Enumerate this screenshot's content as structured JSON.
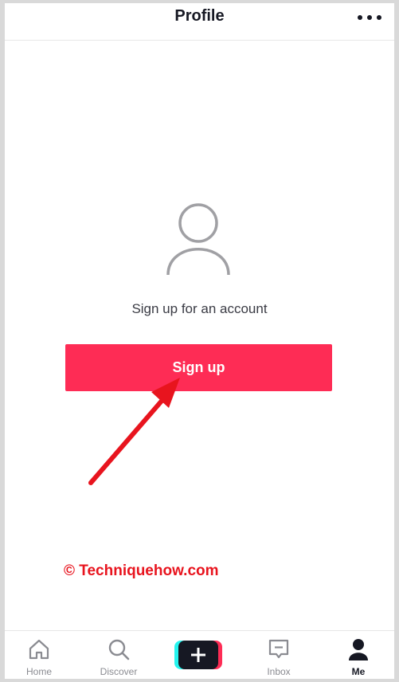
{
  "header": {
    "title": "Profile",
    "menu_icon": "more-horizontal-icon"
  },
  "main": {
    "avatar_icon": "user-placeholder-icon",
    "prompt": "Sign up for an account",
    "signup_label": "Sign up"
  },
  "watermark": "© Techniquehow.com",
  "tabbar": {
    "items": [
      {
        "label": "Home",
        "icon": "home-icon"
      },
      {
        "label": "Discover",
        "icon": "search-icon"
      },
      {
        "label": "",
        "icon": "plus-icon"
      },
      {
        "label": "Inbox",
        "icon": "inbox-icon"
      },
      {
        "label": "Me",
        "icon": "person-icon",
        "active": true
      }
    ]
  },
  "colors": {
    "accent": "#fe2c55",
    "cyan": "#25f4ee",
    "arrow": "#e8141e",
    "text": "#161823"
  }
}
